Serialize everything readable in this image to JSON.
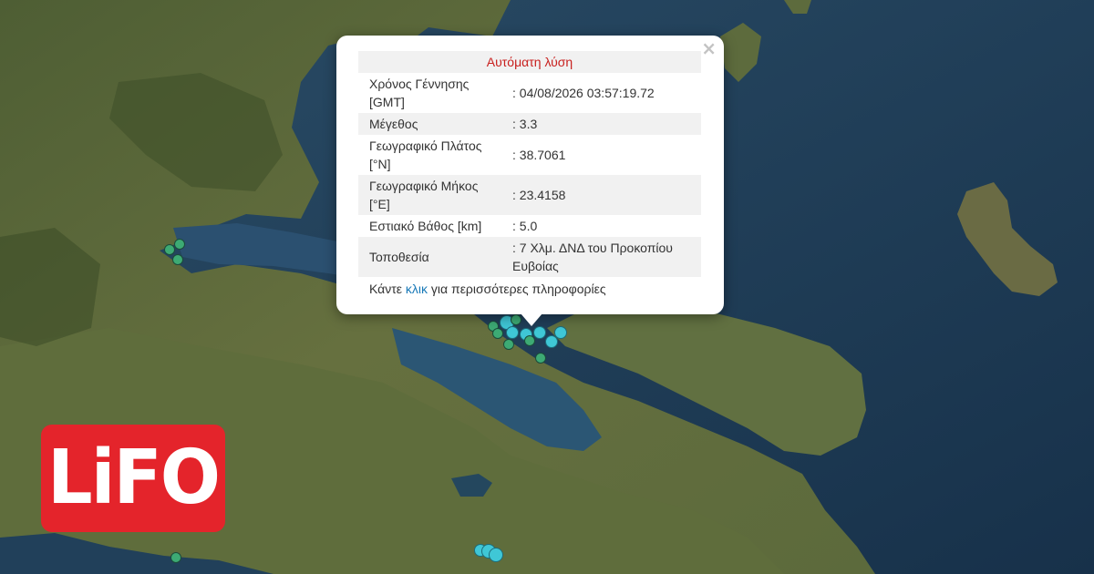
{
  "popup": {
    "title": "Αυτόματη λύση",
    "close_symbol": "×",
    "rows": [
      {
        "label": "Χρόνος Γέννησης [GMT]",
        "value": ": 04/08/2026 03:57:19.72"
      },
      {
        "label": "Μέγεθος",
        "value": ": 3.3"
      },
      {
        "label": "Γεωγραφικό Πλάτος [°N]",
        "value": ": 38.7061"
      },
      {
        "label": "Γεωγραφικό Μήκος [°E]",
        "value": ": 23.4158"
      },
      {
        "label": "Εστιακό Βάθος [km]",
        "value": ": 5.0"
      },
      {
        "label": "Τοποθεσία",
        "value": ": 7 Χλμ. ΔΝΔ του Προκοπίου Ευβοίας"
      }
    ],
    "more_prefix": "Κάντε ",
    "more_link": "κλικ",
    "more_suffix": " για περισσότερες πληροφορίες"
  },
  "logo": {
    "text": "LiFO",
    "color": "#e4242b"
  },
  "colors": {
    "older_event": "#3daa74",
    "recent_event": "#3fc7d6",
    "sea": "#1f3a50",
    "land": "#55653a"
  }
}
